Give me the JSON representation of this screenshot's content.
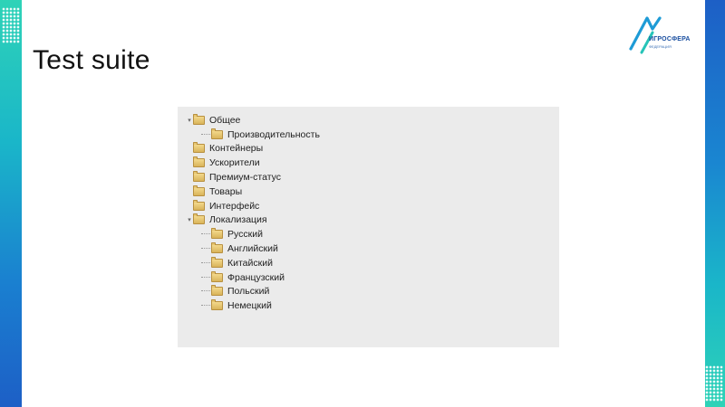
{
  "slide": {
    "title": "Test suite",
    "logo_text": "ИГРОСФЕРА",
    "logo_sub": "ФЕДЕРАЦИЯ"
  },
  "colors": {
    "stripe_teal": "#2ed3b7",
    "stripe_blue": "#1d5fc6",
    "panel_bg": "#ebebeb",
    "folder": "#e6c570"
  },
  "tree": {
    "items": [
      {
        "label": "Общее",
        "level": 0,
        "expanded": true,
        "icon": "folder-icon"
      },
      {
        "label": "Производительность",
        "level": 1,
        "icon": "folder-icon"
      },
      {
        "label": "Контейнеры",
        "level": 0,
        "icon": "folder-icon"
      },
      {
        "label": "Ускорители",
        "level": 0,
        "icon": "folder-icon"
      },
      {
        "label": "Премиум-статус",
        "level": 0,
        "icon": "folder-icon"
      },
      {
        "label": "Товары",
        "level": 0,
        "icon": "folder-icon"
      },
      {
        "label": "Интерфейс",
        "level": 0,
        "icon": "folder-icon"
      },
      {
        "label": "Локализация",
        "level": 0,
        "expanded": true,
        "icon": "folder-icon"
      },
      {
        "label": "Русский",
        "level": 1,
        "icon": "folder-icon"
      },
      {
        "label": "Английский",
        "level": 1,
        "icon": "folder-icon"
      },
      {
        "label": "Китайский",
        "level": 1,
        "icon": "folder-icon"
      },
      {
        "label": "Французский",
        "level": 1,
        "icon": "folder-icon"
      },
      {
        "label": "Польский",
        "level": 1,
        "icon": "folder-icon"
      },
      {
        "label": "Немецкий",
        "level": 1,
        "icon": "folder-icon"
      }
    ]
  }
}
